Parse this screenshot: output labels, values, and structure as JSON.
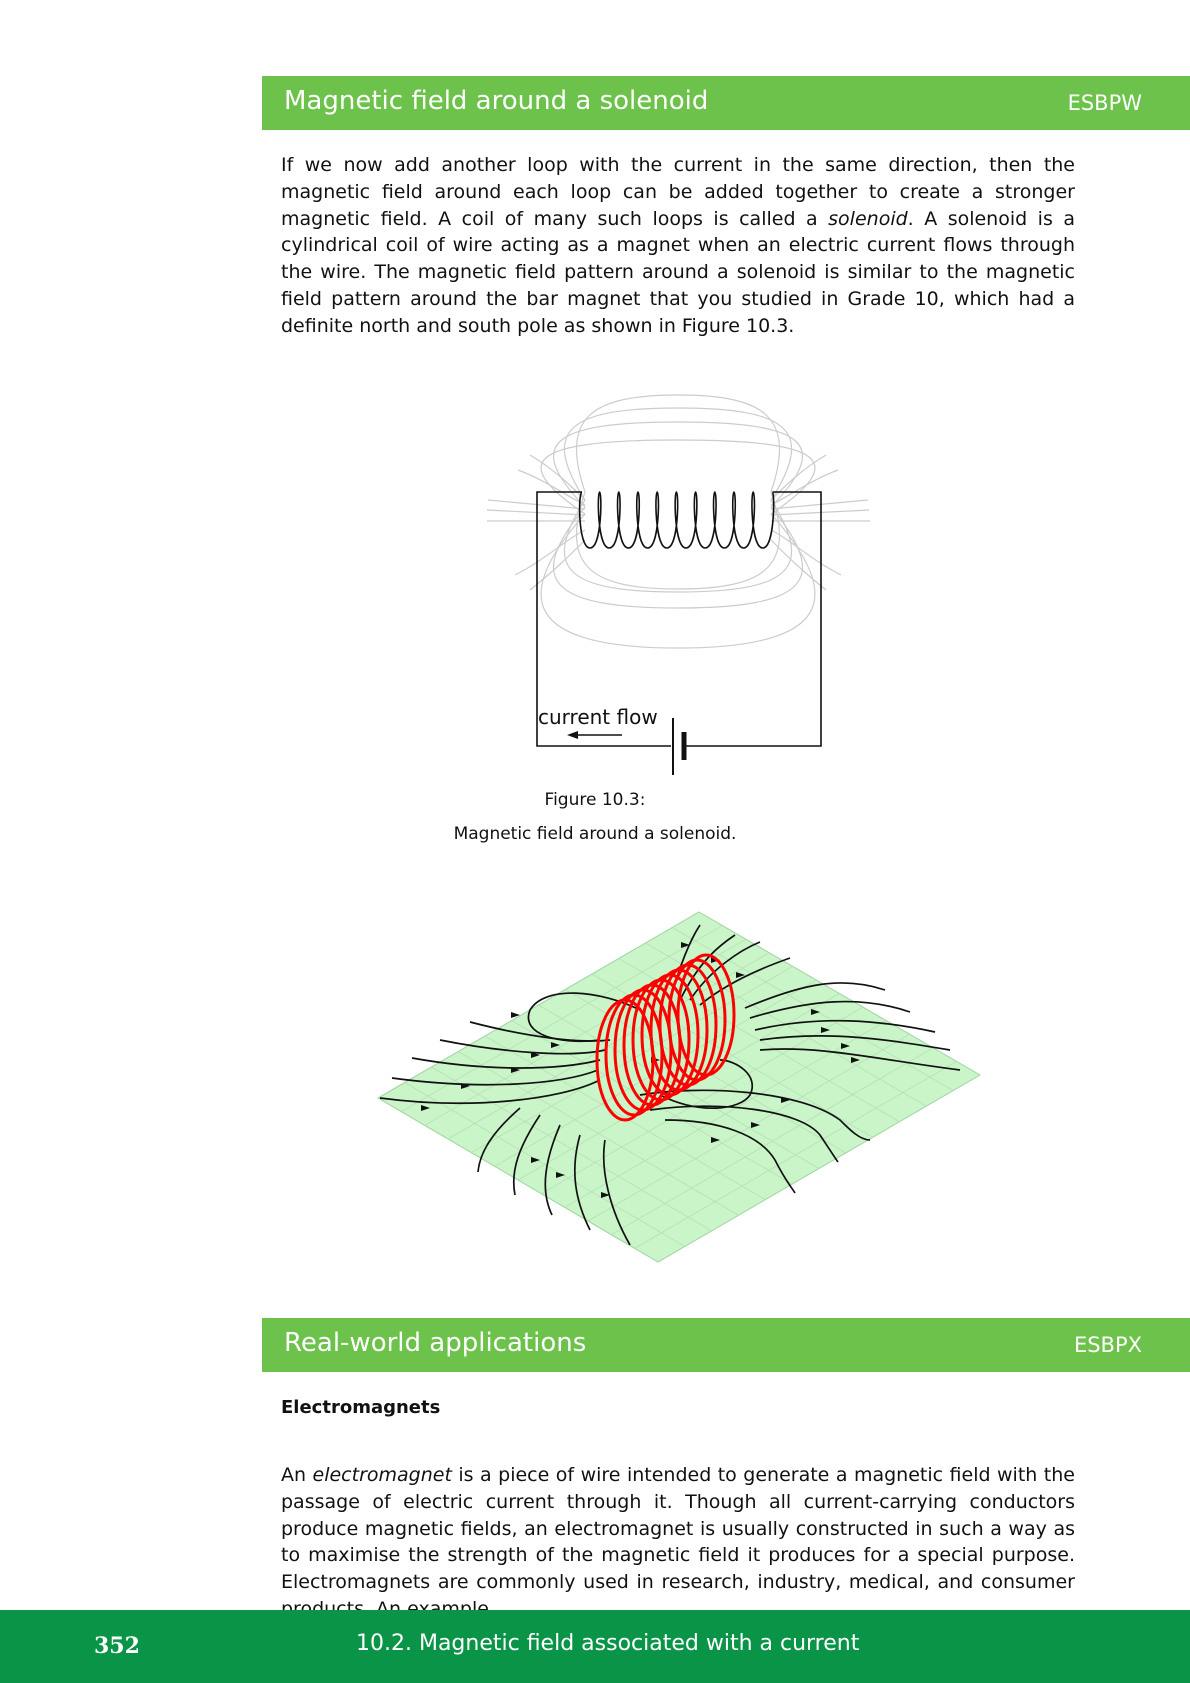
{
  "section1": {
    "title": "Magnetic field around a solenoid",
    "code": "ESBPW"
  },
  "intro": {
    "p1": "If we now add another loop with the current in the same direction, then the magnetic field around each loop can be added together to create a stronger magnetic field.  A coil of many such loops is called a ",
    "em": "solenoid",
    "p2": ".  A solenoid is a cylindrical coil of wire acting as a magnet when an electric current flows through the wire.  The magnetic field pattern around a solenoid is similar to the magnetic field pattern around the bar magnet that you studied in Grade 10, which had a definite north and south pole as shown in Figure 10.3."
  },
  "figure": {
    "label": "current flow",
    "caption_number": "Figure 10.3:",
    "caption_text": "Magnetic field around a solenoid."
  },
  "section2": {
    "title": "Real-world applications",
    "code": "ESBPX"
  },
  "electromagnets": {
    "heading": "Electromagnets",
    "p1": "An ",
    "em": "electromagnet",
    "p2": " is a piece of wire intended to generate a magnetic field with the passage of electric current through it. Though all current-carrying conductors produce magnetic fields, an electromagnet is usually constructed in such a way as to maximise the strength of the magnetic field it produces for a special purpose. Electromagnets are commonly used in research, industry, medical, and consumer products.  An example"
  },
  "footer": {
    "page_number": "352",
    "chapter": "10.2.   Magnetic field associated with a current"
  },
  "colors": {
    "section_bar": "#6cc24a",
    "footer_bar": "#0a9447",
    "coil_3d": "#ff0000",
    "plane": "#c9f5c9"
  }
}
